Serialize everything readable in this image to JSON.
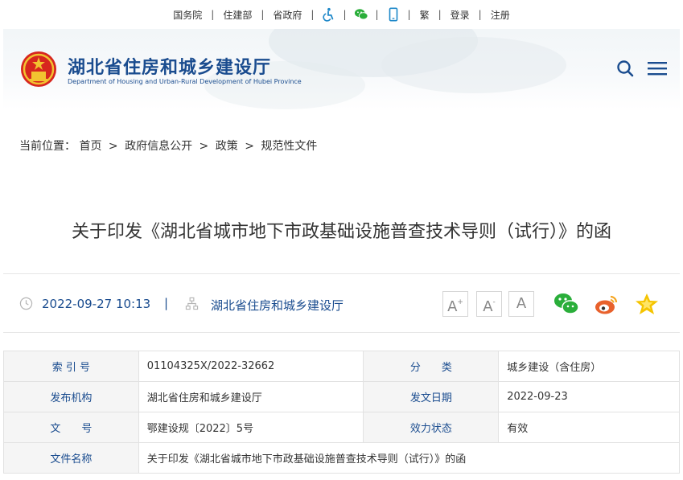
{
  "topbar": {
    "links": [
      "国务院",
      "住建部",
      "省政府"
    ],
    "accessibility_icon": "accessibility-icon",
    "wechat_icon": "wechat-icon",
    "mobile_icon": "mobile-phone-icon",
    "traditional_label": "繁",
    "login_label": "登录",
    "register_label": "注册"
  },
  "header": {
    "title_cn": "湖北省住房和城乡建设厅",
    "title_en": "Department of Housing and Urban-Rural Development of Hubei Province",
    "emblem_icon": "national-emblem-icon",
    "search_icon": "search-icon",
    "menu_icon": "menu-icon"
  },
  "breadcrumb": {
    "prefix": "当前位置：",
    "items": [
      "首页",
      "政府信息公开",
      "政策",
      "规范性文件"
    ],
    "separator": ">"
  },
  "article": {
    "title": "关于印发《湖北省城市地下市政基础设施普查技术导则（试行）》的函",
    "date": "2022-09-27 10:13",
    "divider": "|",
    "source": "湖北省住房和城乡建设厅"
  },
  "font_controls": {
    "increase": "A",
    "increase_sup": "+",
    "decrease": "A",
    "decrease_sup": "-",
    "reset": "A"
  },
  "share": {
    "wechat_icon": "wechat-share-icon",
    "weibo_icon": "weibo-share-icon",
    "favorite_icon": "favorite-star-icon"
  },
  "info_table": {
    "rows": [
      {
        "k1": "索 引 号",
        "v1": "01104325X/2022-32662",
        "k2": "分　　类",
        "v2": "城乡建设（含住房）"
      },
      {
        "k1": "发布机构",
        "v1": "湖北省住房和城乡建设厅",
        "k2": "发文日期",
        "v2": "2022-09-23"
      },
      {
        "k1": "文　　号",
        "v1": "鄂建设规〔2022〕5号",
        "k2": "效力状态",
        "v2": "有效"
      }
    ],
    "name_row": {
      "k": "文件名称",
      "v": "关于印发《湖北省城市地下市政基础设施普查技术导则（试行）》的函"
    }
  },
  "colors": {
    "brand_blue": "#1a4c8f",
    "wechat_green": "#2aae3a",
    "weibo_orange": "#e8612c",
    "star_yellow": "#f5c400"
  }
}
